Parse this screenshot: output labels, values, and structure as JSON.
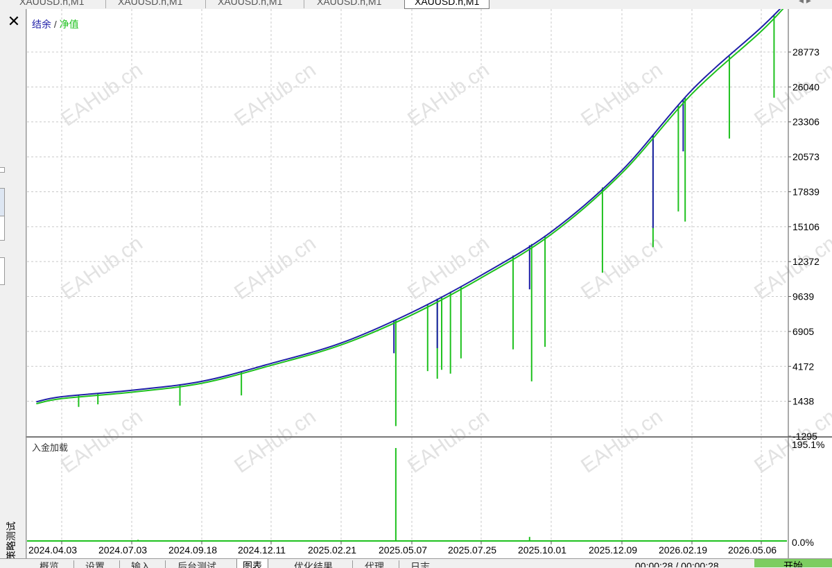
{
  "window": {
    "top_tabs": [
      "XAUUSD.h,M1",
      "XAUUSD.h,M1",
      "XAUUSD.h,M1",
      "XAUUSD.h,M1",
      "XAUUSD.h,M1"
    ],
    "active_tab_index": 4,
    "close_label": "✕",
    "vertical_title": "策略测试"
  },
  "main_chart": {
    "legend_balance": "结余",
    "legend_sep": " / ",
    "legend_equity": "净值",
    "colors": {
      "balance": "#1f1fa8",
      "equity": "#1ec11e",
      "grid": "#c8c8c8",
      "deposit": "#1ec11e"
    },
    "y_ticks": [
      "28773",
      "26040",
      "23306",
      "20573",
      "17839",
      "15106",
      "12372",
      "9639",
      "6905",
      "4172",
      "1438",
      "-1295"
    ],
    "watermark": "EAHub.cn"
  },
  "chart_data": [
    {
      "type": "line",
      "title": "",
      "legend": [
        "结余",
        "净值"
      ],
      "ylim": [
        -1295,
        28773
      ],
      "x_ticks": [
        "2024.04.03",
        "2024.07.03",
        "2024.09.18",
        "2024.12.11",
        "2025.02.21",
        "2025.05.07",
        "2025.07.25",
        "2025.10.01",
        "2025.12.09",
        "2026.02.19",
        "2026.05.06"
      ],
      "series": [
        {
          "name": "结余",
          "x": [
            "2024.03.01",
            "2024.04.03",
            "2024.07.03",
            "2024.09.18",
            "2024.12.11",
            "2025.02.21",
            "2025.05.07",
            "2025.07.25",
            "2025.10.01",
            "2025.12.09",
            "2026.02.19",
            "2026.05.06",
            "2026.06.07"
          ],
          "values": [
            1400,
            1800,
            2300,
            3000,
            4400,
            6000,
            8400,
            11300,
            14700,
            19500,
            25800,
            30700,
            33000
          ]
        },
        {
          "name": "净值",
          "x": [
            "2024.03.01",
            "2024.04.03",
            "2024.07.03",
            "2024.09.18",
            "2024.12.11",
            "2025.02.21",
            "2025.05.07",
            "2025.07.25",
            "2025.10.01",
            "2025.12.09",
            "2026.02.19",
            "2026.05.06",
            "2026.06.07"
          ],
          "values": [
            1250,
            1650,
            2150,
            2850,
            4250,
            5850,
            8200,
            11100,
            14500,
            19300,
            25500,
            30400,
            32800
          ],
          "drawdown_spikes": [
            {
              "x": "2024.04.25",
              "low": 1000
            },
            {
              "x": "2024.05.20",
              "low": 1200
            },
            {
              "x": "2024.08.25",
              "low": 1100
            },
            {
              "x": "2024.11.05",
              "low": 1900
            },
            {
              "x": "2025.04.20",
              "low": -500
            },
            {
              "x": "2025.05.25",
              "low": 3800
            },
            {
              "x": "2025.06.05",
              "low": 3200
            },
            {
              "x": "2025.06.10",
              "low": 3900
            },
            {
              "x": "2025.06.20",
              "low": 3600
            },
            {
              "x": "2025.07.02",
              "low": 4800
            },
            {
              "x": "2025.08.25",
              "low": 5500
            },
            {
              "x": "2025.09.12",
              "low": 3000
            },
            {
              "x": "2025.09.25",
              "low": 5700
            },
            {
              "x": "2025.11.20",
              "low": 11500
            },
            {
              "x": "2026.01.10",
              "low": 13500
            },
            {
              "x": "2026.02.05",
              "low": 16300
            },
            {
              "x": "2026.02.12",
              "low": 15500
            },
            {
              "x": "2026.04.01",
              "low": 22000
            },
            {
              "x": "2026.05.20",
              "low": 25200
            }
          ],
          "balance_spikes": [
            {
              "x": "2025.04.18",
              "high": 5200
            },
            {
              "x": "2025.06.05",
              "high": 5600
            },
            {
              "x": "2025.09.10",
              "high": 10200
            },
            {
              "x": "2026.01.10",
              "high": 15000
            },
            {
              "x": "2026.02.10",
              "high": 21000
            }
          ]
        }
      ]
    },
    {
      "type": "bar",
      "title": "入金加载",
      "ylim": [
        0,
        195.1
      ],
      "y_ticks": [
        "195.1%",
        "0.0%"
      ],
      "x": [
        "2024.07.10",
        "2025.02.01",
        "2025.04.20",
        "2025.06.15",
        "2025.09.10",
        "2025.12.20",
        "2026.03.01"
      ],
      "values": [
        2.5,
        0.8,
        195.1,
        1.2,
        8.5,
        1.0,
        1.5
      ]
    }
  ],
  "deposit_chart": {
    "label": "入金加载",
    "y_ticks": [
      "195.1%",
      "0.0%"
    ]
  },
  "bottom_tabs": [
    "概览",
    "设置",
    "输入",
    "后台测试",
    "图表",
    "优化结果",
    "代理",
    "日志"
  ],
  "active_bottom_tab": 4,
  "status": {
    "timer": "00:00:28 / 00:00:28",
    "start_label": "开始"
  }
}
